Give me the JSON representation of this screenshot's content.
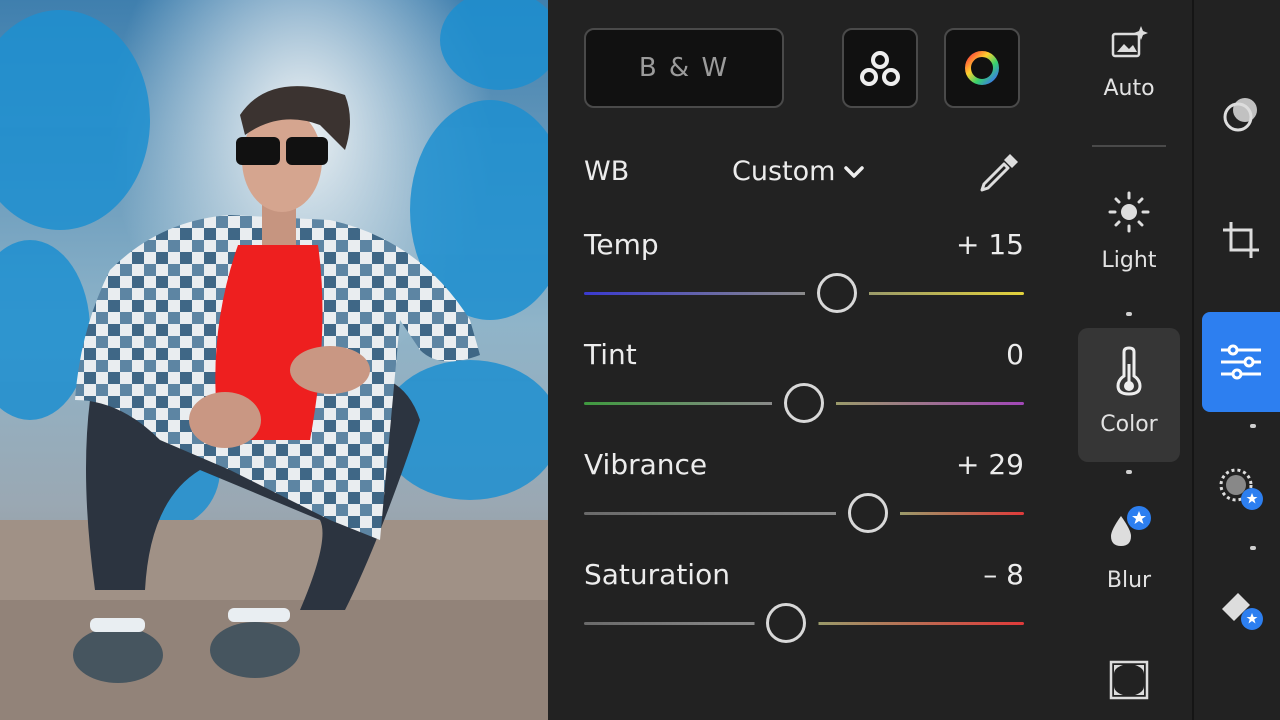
{
  "top_buttons": {
    "bw_label": "B & W",
    "profiles_icon": "profiles-icon",
    "color_mix_icon": "color-wheel-icon"
  },
  "white_balance": {
    "label": "WB",
    "value": "Custom",
    "dropdown_icon": "chevron-down-icon",
    "picker_icon": "eyedropper-icon"
  },
  "sliders": [
    {
      "label": "Temp",
      "value": "+ 15",
      "amount": 15,
      "min": -100,
      "max": 100,
      "gradient": [
        "#3a3ad0",
        "#e3d23c"
      ]
    },
    {
      "label": "Tint",
      "value": "0",
      "amount": 0,
      "min": -100,
      "max": 100,
      "gradient": [
        "#3f9a3f",
        "#a247b8"
      ]
    },
    {
      "label": "Vibrance",
      "value": "+ 29",
      "amount": 29,
      "min": -100,
      "max": 100,
      "gradient": [
        "#6a6a6a",
        "#e03a3a"
      ]
    },
    {
      "label": "Saturation",
      "value": "– 8",
      "amount": -8,
      "min": -100,
      "max": 100,
      "gradient": [
        "#6a6a6a",
        "#e03a3a"
      ]
    }
  ],
  "tools": {
    "auto": "Auto",
    "light": "Light",
    "color": "Color",
    "blur": "Blur"
  },
  "colors": {
    "accent": "#2d7ff0",
    "panel_bg": "#222222",
    "selected_tool_bg": "#363636"
  }
}
